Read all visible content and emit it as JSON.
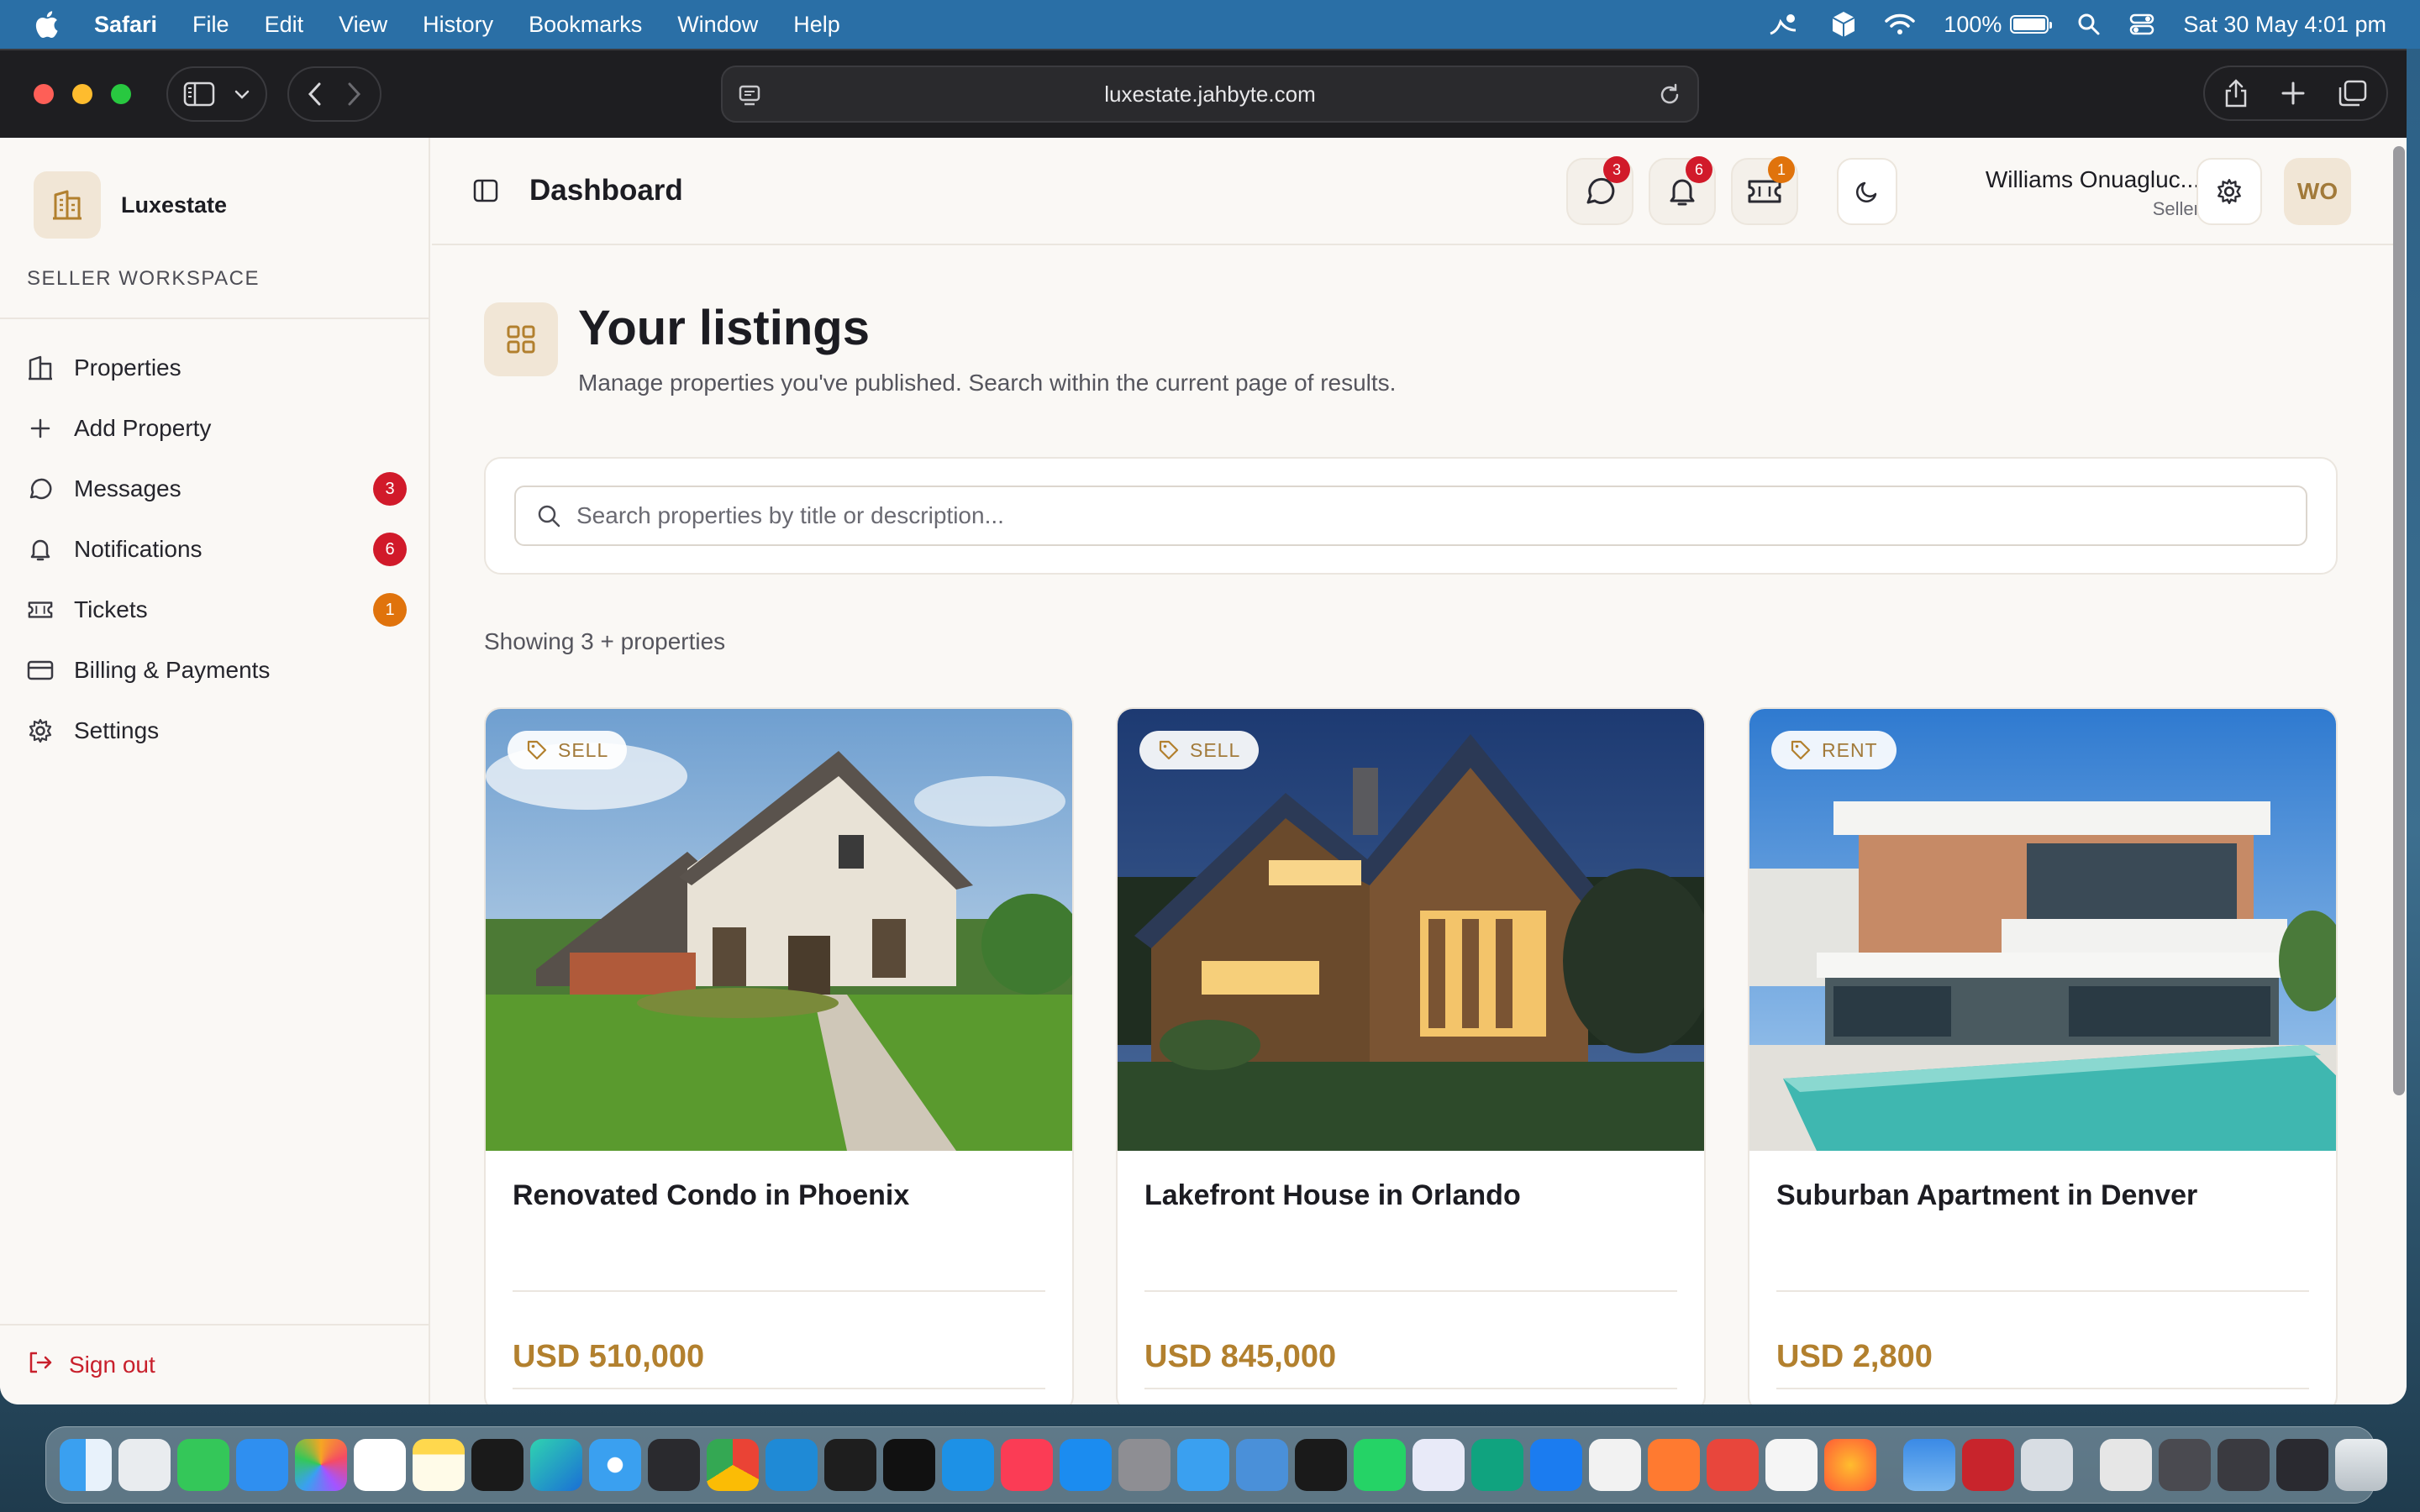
{
  "menubar": {
    "app_name": "Safari",
    "menus": [
      "File",
      "Edit",
      "View",
      "History",
      "Bookmarks",
      "Window",
      "Help"
    ],
    "battery": "100%",
    "datetime": "Sat 30 May  4:01 pm"
  },
  "browser": {
    "url": "luxestate.jahbyte.com"
  },
  "sidebar": {
    "brand": "Luxestate",
    "workspace_label": "SELLER WORKSPACE",
    "items": [
      {
        "label": "Properties",
        "icon": "building-icon"
      },
      {
        "label": "Add Property",
        "icon": "plus-icon"
      },
      {
        "label": "Messages",
        "icon": "message-icon",
        "badge": "3"
      },
      {
        "label": "Notifications",
        "icon": "bell-icon",
        "badge": "6"
      },
      {
        "label": "Tickets",
        "icon": "ticket-icon",
        "badge": "1"
      },
      {
        "label": "Billing & Payments",
        "icon": "card-icon"
      },
      {
        "label": "Settings",
        "icon": "gear-icon"
      }
    ],
    "sign_out": "Sign out"
  },
  "header": {
    "title": "Dashboard",
    "messages_badge": "3",
    "notifications_badge": "6",
    "tickets_badge": "1",
    "user_name": "Williams Onuagluc...",
    "user_role": "Seller",
    "avatar_initials": "WO"
  },
  "page": {
    "title": "Your listings",
    "subtitle": "Manage properties you've published. Search within the current page of results.",
    "search_placeholder": "Search properties by title or description...",
    "showing": "Showing 3 + properties"
  },
  "listings": [
    {
      "tag": "SELL",
      "title": "Renovated Condo in Phoenix",
      "price": "USD 510,000"
    },
    {
      "tag": "SELL",
      "title": "Lakefront House in Orlando",
      "price": "USD 845,000"
    },
    {
      "tag": "RENT",
      "title": "Suburban Apartment in Denver",
      "price": "USD 2,800"
    }
  ],
  "colors": {
    "accent": "#b2802e",
    "badge_red": "#d11a2a",
    "badge_orange": "#e0730c",
    "sign_out": "#c8202c"
  }
}
